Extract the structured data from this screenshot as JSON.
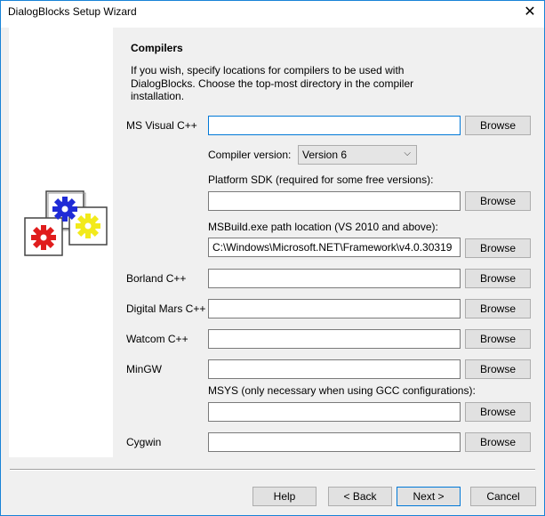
{
  "window": {
    "title": "DialogBlocks Setup Wizard",
    "close_glyph": "✕"
  },
  "page": {
    "heading": "Compilers",
    "intro": "If you wish, specify locations for compilers to be used with DialogBlocks. Choose the top-most directory in the compiler installation."
  },
  "compilers": {
    "msvc": {
      "label": "MS Visual C++",
      "value": "",
      "browse": "Browse"
    },
    "compiler_version": {
      "label": "Compiler version:",
      "selected": "Version 6",
      "arrow": "⌵"
    },
    "platform_sdk": {
      "label": "Platform SDK (required for some free versions):",
      "value": "",
      "browse": "Browse"
    },
    "msbuild": {
      "label": "MSBuild.exe path location (VS 2010 and above):",
      "value": "C:\\Windows\\Microsoft.NET\\Framework\\v4.0.30319",
      "browse": "Browse"
    },
    "borland": {
      "label": "Borland C++",
      "value": "",
      "browse": "Browse"
    },
    "digital_mars": {
      "label": "Digital Mars C++",
      "value": "",
      "browse": "Browse"
    },
    "watcom": {
      "label": "Watcom C++",
      "value": "",
      "browse": "Browse"
    },
    "mingw": {
      "label": "MinGW",
      "value": "",
      "browse": "Browse"
    },
    "msys": {
      "label": "MSYS (only necessary when using GCC configurations):",
      "value": "",
      "browse": "Browse"
    },
    "cygwin": {
      "label": "Cygwin",
      "value": "",
      "browse": "Browse"
    }
  },
  "footer": {
    "help": "Help",
    "back": "< Back",
    "next": "Next >",
    "cancel": "Cancel"
  },
  "colors": {
    "accent": "#0078d7",
    "gear_blue": "#1f2bd6",
    "gear_red": "#e01d1d",
    "gear_yellow": "#f2ea1b"
  },
  "icons": {
    "side_image": "gears-icon"
  }
}
